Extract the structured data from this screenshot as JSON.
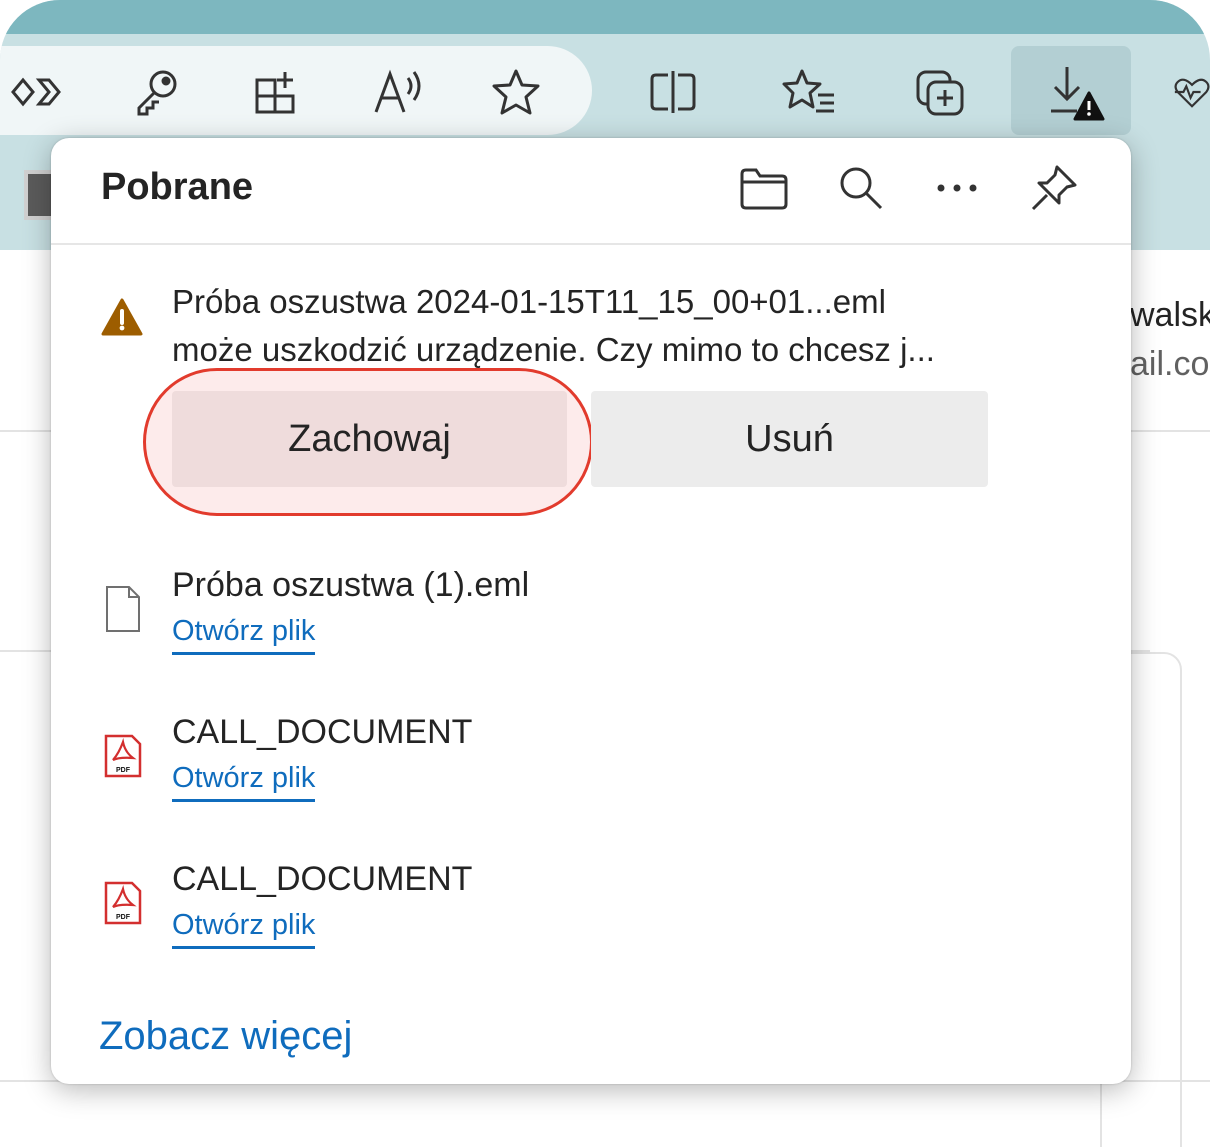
{
  "toolbar": {
    "items": [
      {
        "name": "link-icon"
      },
      {
        "name": "key-icon"
      },
      {
        "name": "add-extension-icon"
      },
      {
        "name": "read-aloud-icon"
      },
      {
        "name": "favorite-star-icon"
      },
      {
        "name": "split-screen-icon"
      },
      {
        "name": "favorites-list-icon"
      },
      {
        "name": "collections-icon"
      },
      {
        "name": "downloads-warning-icon"
      },
      {
        "name": "browser-essentials-icon"
      }
    ]
  },
  "page_behind": {
    "text_line_1": "walsk",
    "text_line_2": "ail.co"
  },
  "downloads_panel": {
    "title": "Pobrane",
    "header_icons": [
      "folder-icon",
      "search-icon",
      "more-options-icon",
      "pin-icon"
    ],
    "warning": {
      "line1": "Próba oszustwa 2024-01-15T11_15_00+01...eml",
      "line2": "może uszkodzić urządzenie. Czy mimo to chcesz j...",
      "keep_label": "Zachowaj",
      "delete_label": "Usuń"
    },
    "items": [
      {
        "name": "Próba oszustwa (1).eml",
        "action": "Otwórz plik",
        "icon": "file-icon"
      },
      {
        "name": "CALL_DOCUMENT",
        "action": "Otwórz plik",
        "icon": "pdf-file-icon"
      },
      {
        "name": "CALL_DOCUMENT",
        "action": "Otwórz plik",
        "icon": "pdf-file-icon"
      }
    ],
    "see_more": "Zobacz więcej"
  },
  "colors": {
    "chrome_top": "#7db7bf",
    "chrome_bg": "#c8e0e3",
    "link": "#0f6cbd",
    "warning": "#9d5d00",
    "highlight": "#e23b2d"
  }
}
